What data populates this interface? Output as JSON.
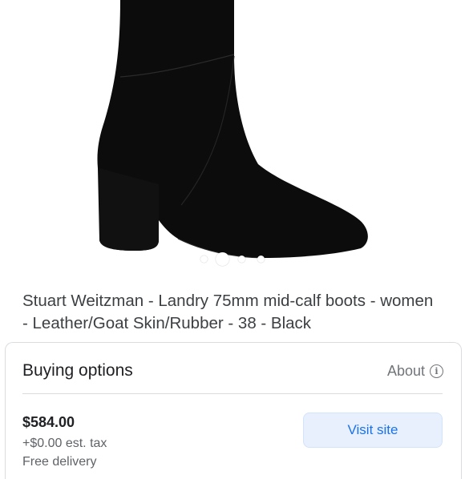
{
  "product": {
    "image_alt": "black suede mid-calf boot with block heel",
    "carousel": {
      "count": 4,
      "active_index": 1
    },
    "title": "Stuart Weitzman - Landry 75mm mid-calf boots - women - Leather/Goat Skin/Rubber - 38 - Black"
  },
  "buying_options": {
    "heading": "Buying options",
    "about_label": "About",
    "about_icon": "info-icon",
    "offer": {
      "price": "$584.00",
      "tax": "+$0.00 est. tax",
      "delivery": "Free delivery",
      "cta_label": "Visit site"
    }
  },
  "colors": {
    "accent": "#1a73e8",
    "button_bg": "#e8f0fe",
    "boot": "#0c0c0c"
  }
}
